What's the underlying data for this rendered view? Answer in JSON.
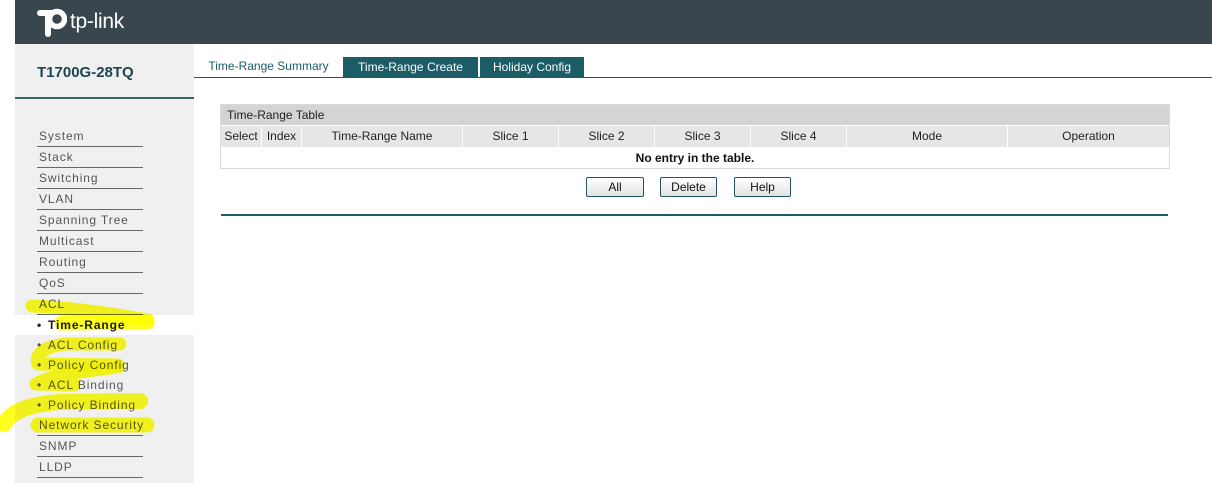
{
  "header": {
    "brand_text": "tp-link"
  },
  "sidebar": {
    "model": "T1700G-28TQ",
    "menu": [
      "System",
      "Stack",
      "Switching",
      "VLAN",
      "Spanning Tree",
      "Multicast",
      "Routing",
      "QoS",
      "ACL"
    ],
    "submenu_bullet": "•",
    "acl_submenu": [
      {
        "label": "Time-Range",
        "active": true
      },
      {
        "label": "ACL Config",
        "active": false
      },
      {
        "label": "Policy Config",
        "active": false
      },
      {
        "label": "ACL Binding",
        "active": false
      },
      {
        "label": "Policy Binding",
        "active": false
      }
    ],
    "menu_after": [
      "Network Security",
      "SNMP",
      "LLDP"
    ]
  },
  "tabs": [
    {
      "label": "Time-Range Summary",
      "active": true
    },
    {
      "label": "Time-Range Create",
      "active": false
    },
    {
      "label": "Holiday Config",
      "active": false
    }
  ],
  "table": {
    "title": "Time-Range Table",
    "columns": [
      "Select",
      "Index",
      "Time-Range Name",
      "Slice 1",
      "Slice 2",
      "Slice 3",
      "Slice 4",
      "Mode",
      "Operation"
    ],
    "empty_message": "No entry in the table."
  },
  "buttons": {
    "all": "All",
    "delete": "Delete",
    "help": "Help"
  },
  "colors": {
    "header_bg": "#39464d",
    "accent": "#1b5c66",
    "sidebar_bg": "#f0f0f0",
    "active_item_bg": "#ffffff",
    "table_title_bg": "#d4d4d4",
    "table_header_bg": "#e6e6e6",
    "highlighter": "#ffff00"
  }
}
